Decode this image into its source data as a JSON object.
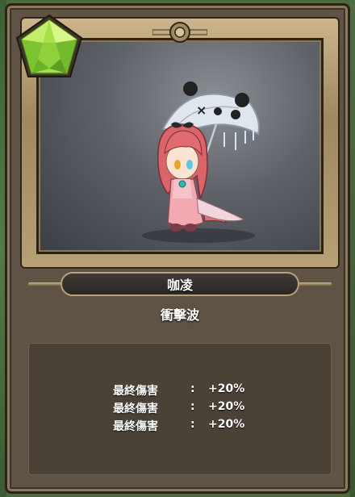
{
  "card": {
    "character_name": "咖凌",
    "skill_name": "衝擊波",
    "gem_icon": "green-star-gem-icon",
    "portrait": "chibi-girl-with-panda-umbrella"
  },
  "stats": [
    {
      "label": "最終傷害",
      "separator": ":",
      "value": "+20%"
    },
    {
      "label": "最終傷害",
      "separator": ":",
      "value": "+20%"
    },
    {
      "label": "最終傷害",
      "separator": ":",
      "value": "+20%"
    }
  ],
  "colors": {
    "frame_gold": "#c9b38a",
    "panel_brown": "#5e5344",
    "stats_bg": "#4a4236",
    "gem_green": "#8fd13a"
  }
}
